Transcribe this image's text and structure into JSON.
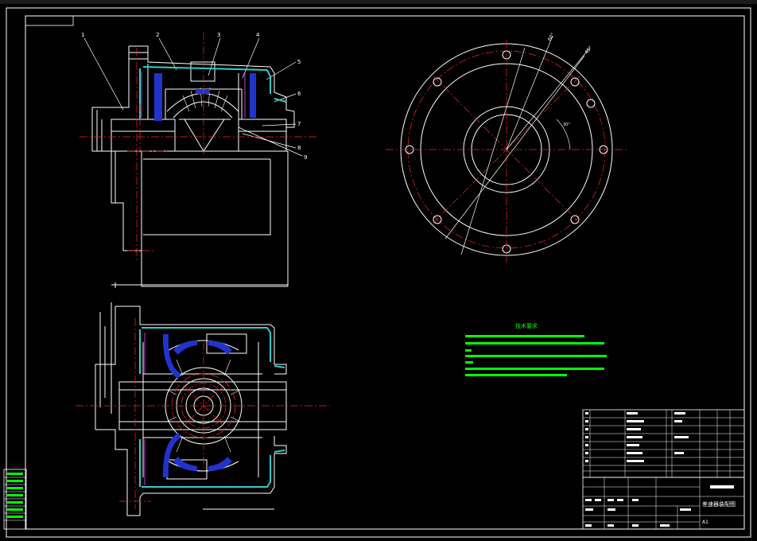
{
  "drawing": {
    "part_labels": [
      "1",
      "2",
      "3",
      "4",
      "5",
      "6",
      "7",
      "8",
      "9"
    ],
    "title_name": "差速器装配图",
    "sheet_size": "A1"
  },
  "tech_requirements": {
    "heading": "技术要求"
  },
  "colors": {
    "background": "#000000",
    "outline": "#ffffff",
    "centerline": "#ff2020",
    "hatch": "#33cccc",
    "part_fill": "#2233cc",
    "text_green": "#00ff00"
  }
}
